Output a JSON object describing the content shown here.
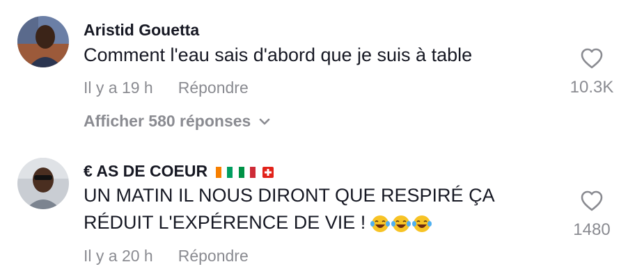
{
  "comments": [
    {
      "username": "Aristid Gouetta",
      "text": "Comment l'eau sais d'abord que je suis à table",
      "time": "Il y a 19 h",
      "reply_label": "Répondre",
      "likes": "10.3K",
      "view_replies": "Afficher 580 réponses",
      "icon": "heart-outline-icon"
    },
    {
      "username": "€ AS DE COEUR",
      "username_flags": [
        "cote-divoire-flag-icon",
        "italy-flag-icon",
        "switzerland-flag-icon"
      ],
      "text": "UN MATIN IL NOUS DIRONT QUE RESPIRÉ ÇA\nRÉDUIT L'EXPÉRENCE DE VIE !",
      "text_emojis": [
        "laughing-tears-emoji",
        "laughing-tears-emoji",
        "laughing-tears-emoji"
      ],
      "time": "Il y a 20 h",
      "reply_label": "Répondre",
      "likes": "1480",
      "icon": "heart-outline-icon"
    }
  ],
  "colors": {
    "primary_text": "#161823",
    "secondary_text": "#8a8b91",
    "background": "#ffffff"
  }
}
